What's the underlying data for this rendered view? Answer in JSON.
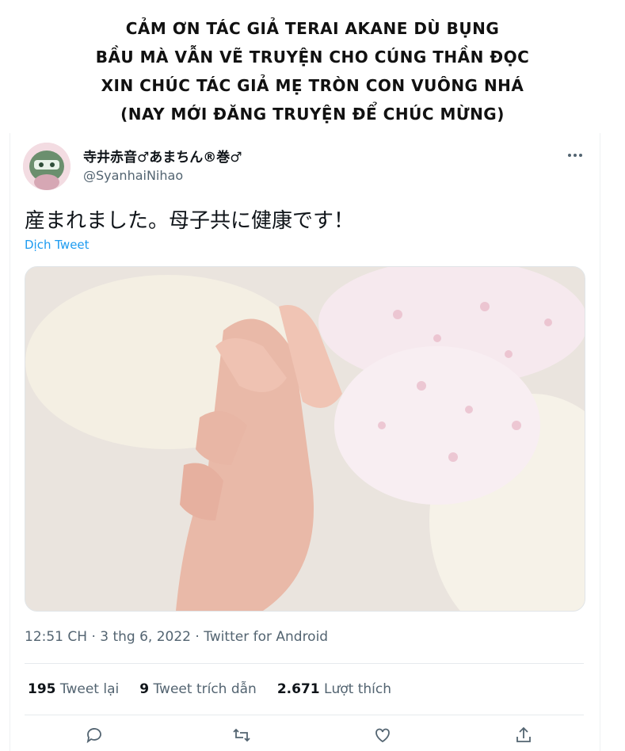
{
  "banner": {
    "line1": "CẢM ƠN TÁC GIẢ TERAI AKANE DÙ BỤNG",
    "line2": "BẦU MÀ VẪN VẼ TRUYỆN CHO CÚNG THẦN ĐỌC",
    "line3": "XIN CHÚC TÁC GIẢ MẸ TRÒN CON VUÔNG NHÁ",
    "line4": "(NAY MỚI ĐĂNG TRUYỆN ĐỂ CHÚC MỪNG)"
  },
  "tweet": {
    "display_name": "寺井赤音♂あまちん®巻♂",
    "handle": "@SyanhaiNihao",
    "text": "産まれました。母子共に健康です！",
    "translate_label": "Dịch Tweet",
    "timestamp": "12:51 CH · 3 thg 6, 2022 · Twitter for Android",
    "stats": {
      "retweets_count": "195",
      "retweets_label": "Tweet lại",
      "quotes_count": "9",
      "quotes_label": "Tweet trích dẫn",
      "likes_count": "2.671",
      "likes_label": "Lượt thích"
    }
  },
  "colors": {
    "link": "#1d9bf0",
    "secondary_text": "#536471",
    "primary_text": "#0f1419"
  },
  "icons": [
    "more-icon",
    "reply-icon",
    "retweet-icon",
    "like-icon",
    "share-icon"
  ]
}
